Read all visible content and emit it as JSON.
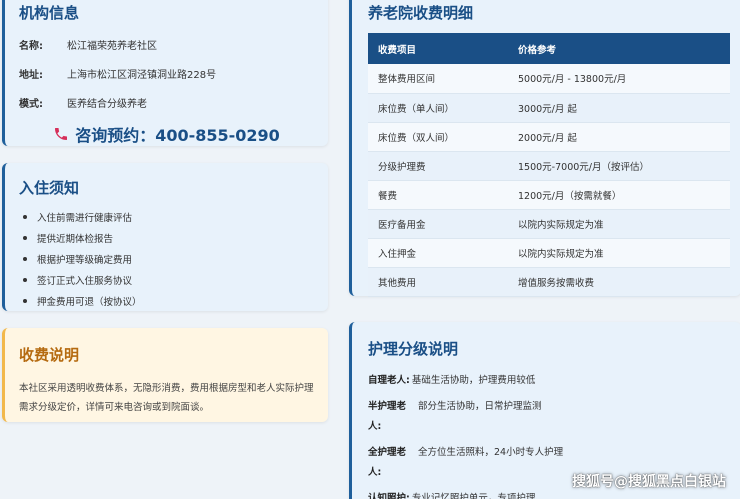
{
  "org": {
    "title": "机构信息",
    "rows": [
      {
        "label": "名称:",
        "value": "松江福荣苑养老社区"
      },
      {
        "label": "地址:",
        "value": "上海市松江区洞泾镇洞业路228号"
      },
      {
        "label": "模式:",
        "value": "医养结合分级养老"
      }
    ],
    "phone_text": "咨询预约：400-855-0290"
  },
  "notice": {
    "title": "入住须知",
    "items": [
      "入住前需进行健康评估",
      "提供近期体检报告",
      "根据护理等级确定费用",
      "签订正式入住服务协议",
      "押金费用可退（按协议）"
    ]
  },
  "fee": {
    "title": "收费说明",
    "text": "本社区采用透明收费体系，无隐形消费，费用根据房型和老人实际护理需求分级定价，详情可来电咨询或到院面谈。"
  },
  "price": {
    "title": "养老院收费明细",
    "headers": [
      "收费项目",
      "价格参考"
    ],
    "rows": [
      [
        "整体费用区间",
        "5000元/月 - 13800元/月"
      ],
      [
        "床位费（单人间）",
        "3000元/月 起"
      ],
      [
        "床位费（双人间）",
        "2000元/月 起"
      ],
      [
        "分级护理费",
        "1500元-7000元/月（按评估）"
      ],
      [
        "餐费",
        "1200元/月（按需就餐）"
      ],
      [
        "医疗备用金",
        "以院内实际规定为准"
      ],
      [
        "入住押金",
        "以院内实际规定为准"
      ],
      [
        "其他费用",
        "增值服务按需收费"
      ]
    ]
  },
  "care": {
    "title": "护理分级说明",
    "rows": [
      {
        "label": "自理老人:",
        "value": "基础生活协助，护理费用较低"
      },
      {
        "label": "半护理老人:",
        "value": "部分生活协助，日常护理监测"
      },
      {
        "label": "全护理老人:",
        "value": "全方位生活照料，24小时专人护理"
      },
      {
        "label": "认知照护:",
        "value": "专业记忆照护单元，专项护理"
      }
    ]
  },
  "watermark": "搜狐号@搜狐黑点白银站",
  "colors": {
    "accent": "#1a4f86",
    "fee_title": "#b56a10",
    "phone_icon": "#d62f5a"
  }
}
